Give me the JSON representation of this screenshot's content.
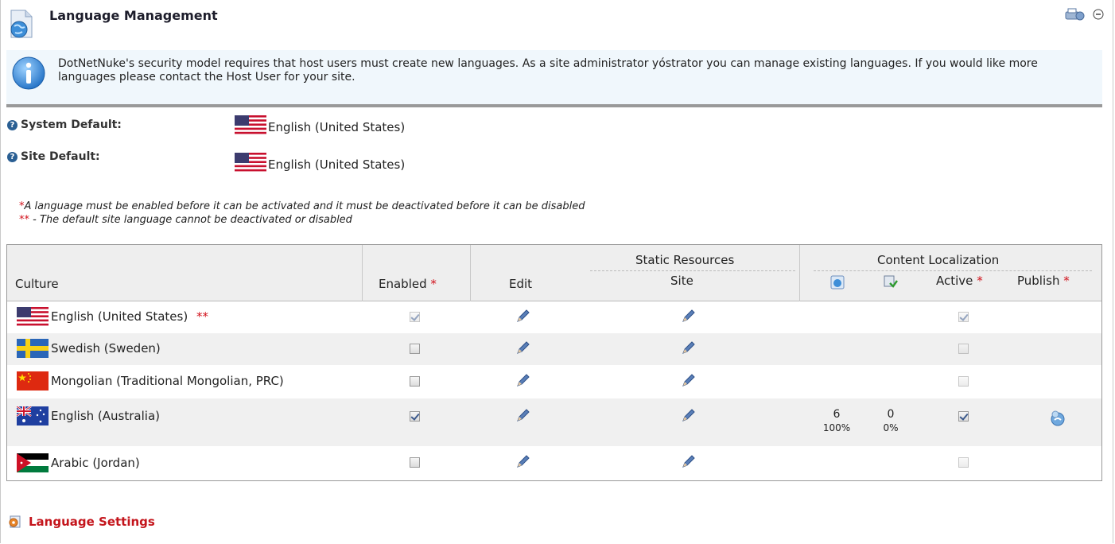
{
  "module": {
    "title": "Language Management",
    "info_text": "DotNetNuke's security model requires that host users must create new languages. As a site administrator yóstrator you can manage existing languages. If you would like more languages please contact the Host User for your site."
  },
  "defaults": {
    "system_label": "System Default:",
    "system_value": "English (United States)",
    "site_label": "Site Default:",
    "site_value": "English (United States)"
  },
  "notes": {
    "note1_marker": "*",
    "note1": "A language must be enabled before it can be activated and it must be deactivated before it can be disabled",
    "note2_marker": "**",
    "note2": " - The default site language cannot be deactivated or disabled"
  },
  "table": {
    "headers": {
      "culture": "Culture",
      "enabled": "Enabled",
      "edit": "Edit",
      "static_resources": "Static Resources",
      "site": "Site",
      "content_localization": "Content Localization",
      "active": "Active",
      "publish": "Publish",
      "required_marker": "*"
    },
    "rows": [
      {
        "culture": "English (United States)",
        "marker": "**",
        "flag": "us",
        "enabled": true,
        "enabled_disabled": true,
        "active": true,
        "active_disabled": true,
        "count1": "",
        "pct1": "",
        "count2": "",
        "pct2": "",
        "publish": false
      },
      {
        "culture": "Swedish (Sweden)",
        "marker": "",
        "flag": "se",
        "enabled": false,
        "enabled_disabled": false,
        "active": false,
        "active_disabled": true,
        "count1": "",
        "pct1": "",
        "count2": "",
        "pct2": "",
        "publish": false
      },
      {
        "culture": "Mongolian (Traditional Mongolian, PRC)",
        "marker": "",
        "flag": "cn",
        "enabled": false,
        "enabled_disabled": false,
        "active": false,
        "active_disabled": true,
        "count1": "",
        "pct1": "",
        "count2": "",
        "pct2": "",
        "publish": false
      },
      {
        "culture": "English (Australia)",
        "marker": "",
        "flag": "au",
        "enabled": true,
        "enabled_disabled": false,
        "active": true,
        "active_disabled": false,
        "count1": "6",
        "pct1": "100%",
        "count2": "0",
        "pct2": "0%",
        "publish": true
      },
      {
        "culture": "Arabic (Jordan)",
        "marker": "",
        "flag": "jo",
        "enabled": false,
        "enabled_disabled": false,
        "active": false,
        "active_disabled": true,
        "count1": "",
        "pct1": "",
        "count2": "",
        "pct2": "",
        "publish": false
      }
    ]
  },
  "footer": {
    "language_settings": "Language Settings"
  },
  "colors": {
    "accent_red": "#d1101a",
    "link_red": "#c4151c",
    "header_bg": "#eeeeee",
    "alt_row_bg": "#f0f0f0"
  }
}
